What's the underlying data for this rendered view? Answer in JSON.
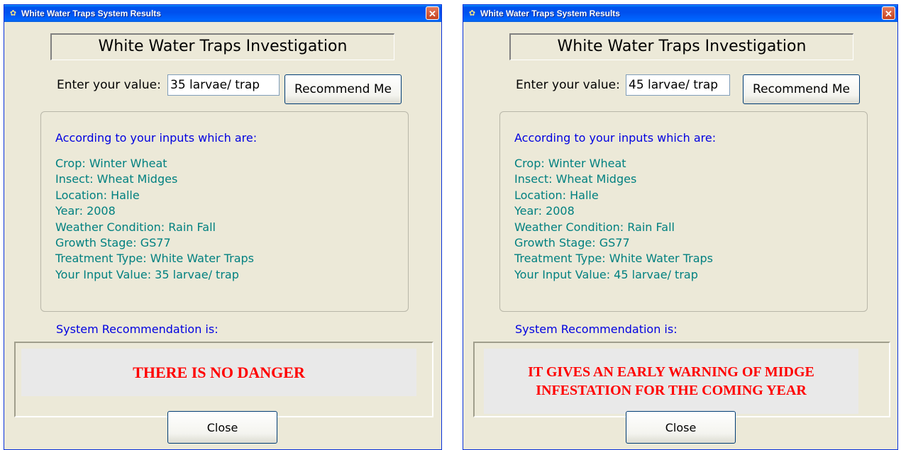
{
  "windows": [
    {
      "title": "White Water Traps System Results",
      "close_glyph": "✕",
      "title_icon": "app-icon",
      "heading": "White Water Traps Investigation",
      "enter_label": "Enter your value:",
      "input_value": "35 larvae/ trap",
      "recommend_label": "Recommend Me",
      "info_header": "According to your inputs which are:",
      "info_lines": [
        "Crop: Winter Wheat",
        "Insect: Wheat Midges",
        "Location: Halle",
        "Year: 2008",
        "Weather Condition: Rain Fall",
        "Growth Stage: GS77",
        "Treatment Type: White Water Traps",
        "Your Input Value: 35 larvae/ trap"
      ],
      "sysrec_label": "System Recommendation is:",
      "result_lines": [
        "THERE IS NO DANGER"
      ],
      "close_label": "Close"
    },
    {
      "title": "White Water Traps System Results",
      "close_glyph": "✕",
      "title_icon": "app-icon",
      "heading": "White Water Traps Investigation",
      "enter_label": "Enter your value:",
      "input_value": "45 larvae/ trap",
      "recommend_label": "Recommend Me",
      "info_header": "According to your inputs which are:",
      "info_lines": [
        "Crop: Winter Wheat",
        "Insect: Wheat Midges",
        "Location: Halle",
        "Year: 2008",
        "Weather Condition: Rain Fall",
        "Growth Stage: GS77",
        "Treatment Type: White Water Traps",
        "Your Input Value: 45 larvae/ trap"
      ],
      "sysrec_label": "System Recommendation is:",
      "result_lines": [
        "IT GIVES AN EARLY WARNING OF MIDGE",
        "INFESTATION FOR THE COMING YEAR"
      ],
      "close_label": "Close"
    }
  ],
  "colors": {
    "title_bar": "#0053ee",
    "window_bg": "#ece9d8",
    "header_text": "#0000e0",
    "info_text": "#008080",
    "result_text": "#ff0000"
  }
}
